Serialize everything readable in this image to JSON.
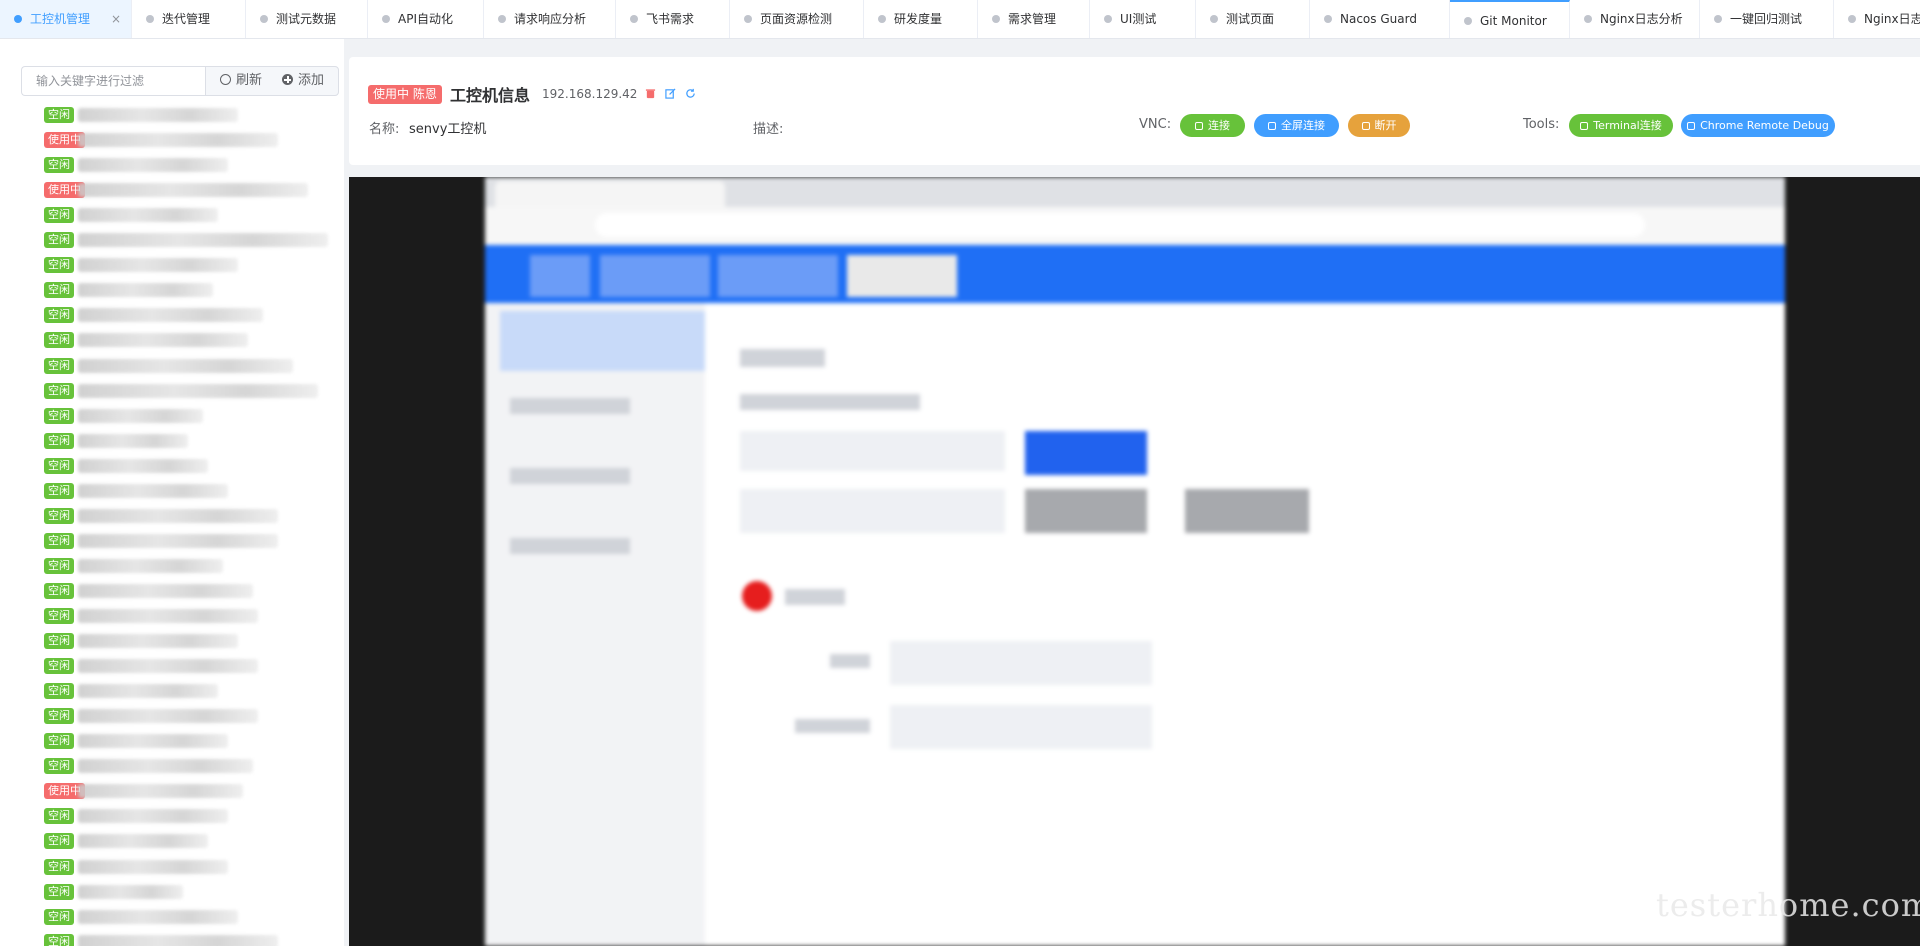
{
  "tabs": [
    {
      "label": "工控机管理",
      "active": true,
      "closable": true
    },
    {
      "label": "迭代管理"
    },
    {
      "label": "测试元数据"
    },
    {
      "label": "API自动化"
    },
    {
      "label": "请求响应分析"
    },
    {
      "label": "飞书需求"
    },
    {
      "label": "页面资源检测"
    },
    {
      "label": "研发度量"
    },
    {
      "label": "需求管理"
    },
    {
      "label": "UI测试"
    },
    {
      "label": "测试页面"
    },
    {
      "label": "Nacos Guard"
    },
    {
      "label": "Git Monitor"
    },
    {
      "label": "Nginx日志分析"
    },
    {
      "label": "一键回归测试"
    },
    {
      "label": "Nginx日志"
    }
  ],
  "tab_close_glyph": "×",
  "sidebar": {
    "filter_placeholder": "输入关键字进行过滤",
    "refresh_label": "刷新",
    "add_label": "添加",
    "badge_idle": "空闲",
    "badge_busy": "使用中",
    "machines": [
      "idle",
      "busy",
      "idle",
      "busy",
      "idle",
      "idle",
      "idle",
      "idle",
      "idle",
      "idle",
      "idle",
      "idle",
      "idle",
      "idle",
      "idle",
      "idle",
      "idle",
      "idle",
      "idle",
      "idle",
      "idle",
      "idle",
      "idle",
      "idle",
      "idle",
      "idle",
      "idle",
      "busy",
      "idle",
      "idle",
      "idle",
      "idle",
      "idle",
      "idle",
      "idle"
    ]
  },
  "info": {
    "status_tag": "使用中 陈恩",
    "title": "工控机信息",
    "ip": "192.168.129.42",
    "name_label": "名称:",
    "name_value": "senvy工控机",
    "desc_label": "描述:",
    "desc_value": "",
    "vnc_label": "VNC:",
    "vnc_connect": "连接",
    "vnc_fullscreen": "全屏连接",
    "vnc_disconnect": "断开",
    "tools_label": "Tools:",
    "terminal": "Terminal连接",
    "chrome_debug": "Chrome Remote Debug"
  },
  "watermark": "testerhome.com",
  "colors": {
    "primary": "#409eff",
    "success": "#67c23a",
    "danger": "#f56c6c",
    "warning": "#e6a23c"
  }
}
